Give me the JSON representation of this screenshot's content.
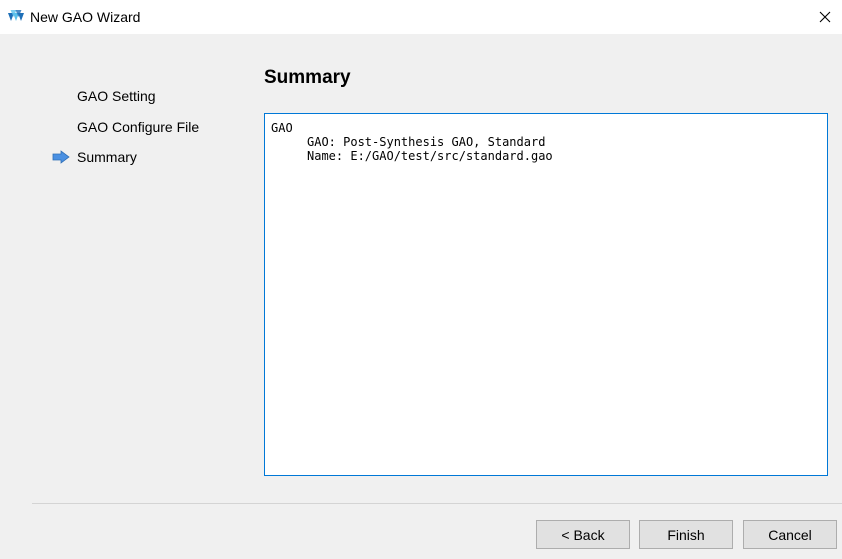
{
  "window": {
    "title": "New GAO Wizard",
    "close_glyph": "×"
  },
  "nav": {
    "items": [
      {
        "label": "GAO Setting",
        "active": false
      },
      {
        "label": "GAO Configure File",
        "active": false
      },
      {
        "label": "Summary",
        "active": true
      }
    ],
    "active_indicator_icon": "arrow-right-icon"
  },
  "page": {
    "title": "Summary",
    "summary_lines": [
      "GAO",
      "GAO: Post-Synthesis GAO, Standard",
      "Name: E:/GAO/test/src/standard.gao"
    ]
  },
  "buttons": {
    "back": "< Back",
    "finish": "Finish",
    "cancel": "Cancel"
  },
  "colors": {
    "accent_border": "#0078d7",
    "arrow_fill": "#4a90e2",
    "logo_light": "#5bc0eb",
    "logo_dark": "#1e6fb8"
  }
}
